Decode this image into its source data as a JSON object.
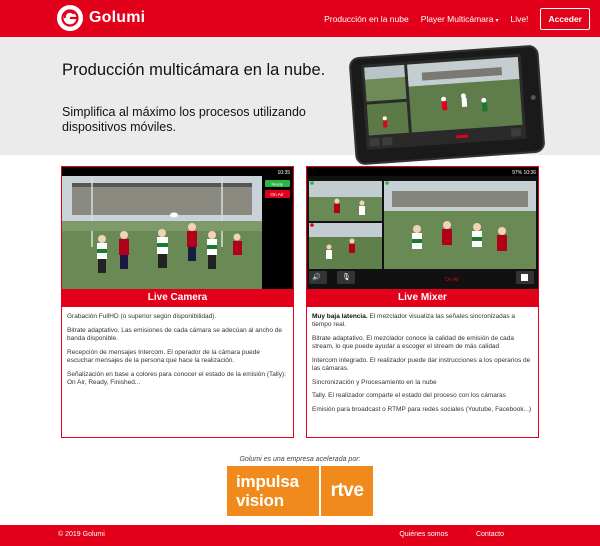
{
  "nav": {
    "brand": "Golumi",
    "links": [
      "Producción en la nube",
      "Player Multicámara",
      "Live!"
    ],
    "acceder": "Acceder"
  },
  "hero": {
    "title": "Producción multicámara en la nube.",
    "subtitle": "Simplifica al máximo los procesos utilizando dispositivos móviles."
  },
  "phone_status": {
    "camera_time": "10:35",
    "mixer_status": "97% 10:36",
    "on_air": "On Air",
    "ready": "Ready"
  },
  "cards": [
    {
      "title": "Live Camera",
      "paragraphs": [
        {
          "bold": "",
          "text": "Grabación FullHD (o superior según disponibilidad)."
        },
        {
          "bold": "",
          "text": "Bitrate adaptativo. Las emisiones de cada cámara se adecúan al ancho de banda disponible."
        },
        {
          "bold": "",
          "text": "Recepción de mensajes Intercom. El operador de la cámara puede escuchar mensajes de la persona que hace la realización."
        },
        {
          "bold": "",
          "text": "Señalización en base a colores para conocer el estado de la emisión (Tally): On Air, Ready, Finished..."
        }
      ]
    },
    {
      "title": "Live Mixer",
      "paragraphs": [
        {
          "bold": "Muy baja latencia.",
          "text": " El mezclador visualiza las señales sincronizadas a tiempo real."
        },
        {
          "bold": "",
          "text": "Bitrate adaptativo. El mezclador conoce la calidad de emisión de cada stream, lo que puede ayudar a escoger el stream de más calidad"
        },
        {
          "bold": "",
          "text": "Intercom integrado. El realizador puede dar instrucciones a los operarios de las cámaras."
        },
        {
          "bold": "",
          "text": "Sincronización y Procesamiento en la nube"
        },
        {
          "bold": "",
          "text": "Tally. El realizador comparte el estado del proceso con los cámaras"
        },
        {
          "bold": "",
          "text": "Emisión para broadcast o RTMP para redes sociales (Youtube, Facebook...)"
        }
      ]
    }
  ],
  "partner": {
    "caption": "Golumi es una empresa acelerada por:",
    "impulsa_line1": "impulsa",
    "impulsa_line2": "vision",
    "rtve": "rtve"
  },
  "footer": {
    "copyright": "© 2019 Golumi",
    "links": [
      "Quiénes somos",
      "Contacto"
    ]
  },
  "colors": {
    "brand_red": "#e2001a",
    "partner_orange": "#f08a1c",
    "hero_bg": "#ebebeb"
  },
  "icons": [
    "golumi-logo-icon",
    "caret-down-icon",
    "speaker-icon",
    "microphone-icon",
    "stop-icon",
    "wifi-icon",
    "battery-icon"
  ]
}
